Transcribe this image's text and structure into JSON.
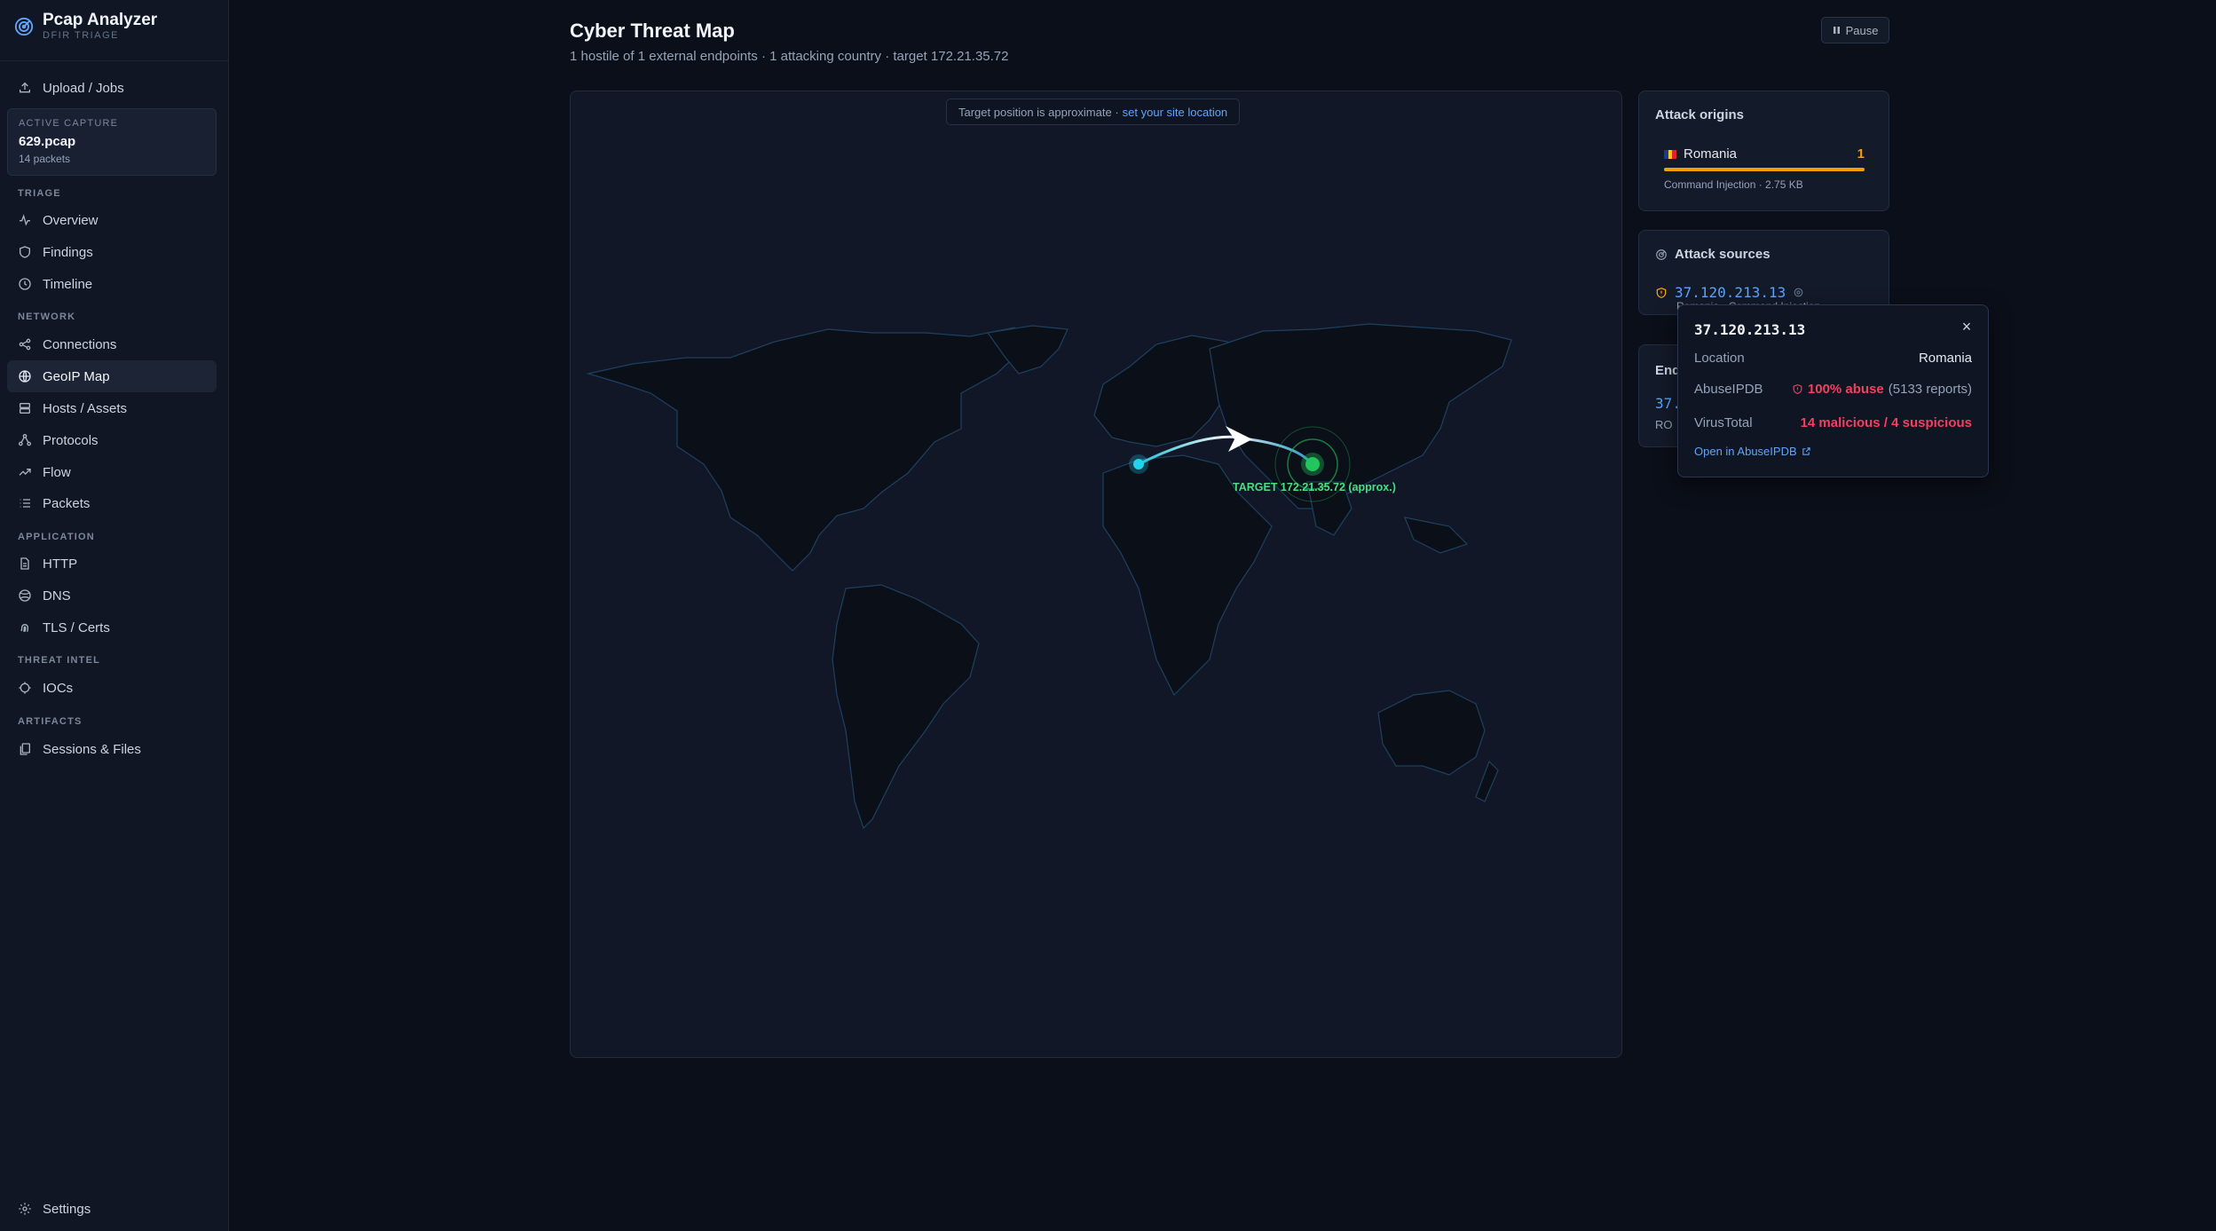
{
  "app": {
    "title": "Pcap Analyzer",
    "subtitle": "DFIR TRIAGE"
  },
  "sidebar": {
    "upload_label": "Upload / Jobs",
    "capture": {
      "label": "ACTIVE CAPTURE",
      "name": "629.pcap",
      "packets": "14 packets"
    },
    "sections": {
      "triage": "TRIAGE",
      "network": "NETWORK",
      "application": "APPLICATION",
      "threat_intel": "THREAT INTEL",
      "artifacts": "ARTIFACTS"
    },
    "items": {
      "overview": "Overview",
      "findings": "Findings",
      "timeline": "Timeline",
      "connections": "Connections",
      "geoip": "GeoIP Map",
      "hosts": "Hosts / Assets",
      "protocols": "Protocols",
      "flow": "Flow",
      "packets": "Packets",
      "http": "HTTP",
      "dns": "DNS",
      "tls": "TLS / Certs",
      "iocs": "IOCs",
      "sessions": "Sessions & Files"
    },
    "settings_label": "Settings"
  },
  "header": {
    "title": "Cyber Threat Map",
    "subtitle": "1 hostile of 1 external endpoints · 1 attacking country · target 172.21.35.72",
    "pause_label": "Pause"
  },
  "map": {
    "notice_text": "Target position is approximate ·",
    "notice_link": "set your site location",
    "target_label": "TARGET 172.21.35.72 (approx.)",
    "colors": {
      "arc": "#38bdf8",
      "target": "#22c55e",
      "source": "#22d3ee"
    }
  },
  "origins": {
    "title": "Attack origins",
    "items": [
      {
        "country": "Romania",
        "count": "1",
        "detail": "Command Injection · 2.75 KB",
        "share": 1.0
      }
    ]
  },
  "sources": {
    "title": "Attack sources",
    "items": [
      {
        "ip": "37.120.213.13",
        "detail": "Romania · Command Injection"
      }
    ]
  },
  "endpoints": {
    "title": "Endpoints",
    "items": [
      {
        "ip": "37.120.213.13",
        "cc": "RO"
      }
    ]
  },
  "popover": {
    "ip": "37.120.213.13",
    "location_label": "Location",
    "location_value": "Romania",
    "abuse_label": "AbuseIPDB",
    "abuse_value": "100% abuse",
    "abuse_reports": "(5133 reports)",
    "vt_label": "VirusTotal",
    "vt_value": "14 malicious / 4 suspicious",
    "link": "Open in AbuseIPDB"
  }
}
